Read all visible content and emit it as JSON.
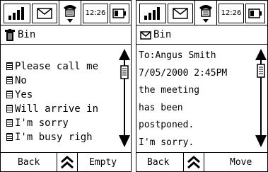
{
  "left": {
    "status": {
      "time": "12:26"
    },
    "title": "Bin",
    "messages": [
      {
        "label": "Please call me"
      },
      {
        "label": "No"
      },
      {
        "label": "Yes"
      },
      {
        "label": "Will arrive in"
      },
      {
        "label": "I'm sorry"
      },
      {
        "label": "I'm busy righ"
      }
    ],
    "softkeys": {
      "left": "Back",
      "right": "Empty"
    }
  },
  "right": {
    "status": {
      "time": "12:26"
    },
    "title": "Bin",
    "detail": {
      "to": "To:Angus Smith",
      "datetime": "7/05/2000 2:45PM",
      "body_lines": [
        "the meeting",
        "has been",
        "postponed.",
        "I'm sorry."
      ]
    },
    "softkeys": {
      "left": "Back",
      "right": "Move"
    }
  },
  "icons": {
    "signal": "signal-strength-icon",
    "envelope": "envelope-icon",
    "phone": "phone-icon",
    "battery": "battery-icon",
    "bin": "trash-bin-icon",
    "message": "message-icon",
    "scroll_up": "arrow-up-icon",
    "scroll_down": "arrow-down-icon",
    "menu": "double-chevron-up-icon"
  }
}
